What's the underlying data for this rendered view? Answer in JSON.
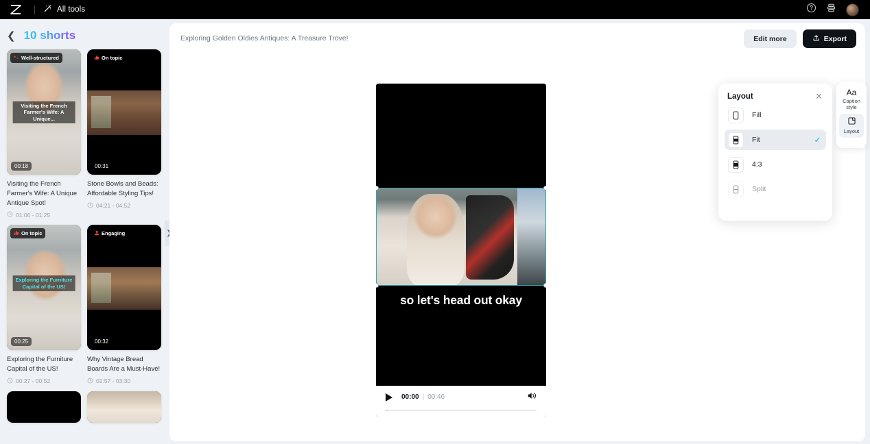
{
  "topbar": {
    "logo_icon": "capcut-logo-icon",
    "all_tools_label": "All tools",
    "all_tools_icon": "magic-wand-icon",
    "help_icon": "help-circle-icon",
    "print_icon": "layers-icon",
    "avatar_icon": "user-avatar"
  },
  "sidebar": {
    "back_icon": "chevron-left-icon",
    "title": "10 shorts",
    "collapse_icon": "chevron-right-icon",
    "cards": [
      {
        "badge": "Well-structured",
        "badge_icon": "sparkles-icon",
        "duration": "00:18",
        "title": "Visiting the French Farmer's Wife: A Unique Antique Spot!",
        "range": "01:06 - 01:25",
        "clock_icon": "clock-icon",
        "overlay_caption": "Visiting the French Farmer's Wife: A Unique...",
        "thumb_kind": "face1"
      },
      {
        "badge": "On topic",
        "badge_icon": "thumbs-up-icon",
        "duration": "00:31",
        "title": "Stone Bowls and Beads: Affordable Styling Tips!",
        "range": "04:21 - 04:52",
        "clock_icon": "clock-icon",
        "overlay_caption": "",
        "thumb_kind": "room"
      },
      {
        "badge": "On topic",
        "badge_icon": "thumbs-up-icon",
        "duration": "00:25",
        "title": "Exploring the Furniture Capital of the US!",
        "range": "00:27 - 00:52",
        "clock_icon": "clock-icon",
        "overlay_caption": "Exploring the Furniture Capital of the US!",
        "thumb_kind": "face2"
      },
      {
        "badge": "Engaging",
        "badge_icon": "person-icon",
        "duration": "00:32",
        "title": "Why Vintage Bread Boards Are a Must-Have!",
        "range": "02:57 - 03:30",
        "clock_icon": "clock-icon",
        "overlay_caption": "",
        "thumb_kind": "room-b"
      },
      {
        "badge": "",
        "duration": "",
        "title": "",
        "range": "",
        "thumb_kind": "black"
      },
      {
        "badge": "",
        "duration": "",
        "title": "",
        "range": "",
        "thumb_kind": "hair"
      }
    ]
  },
  "main": {
    "project_title": "Exploring Golden Oldies Antiques: A Treasure Trove!",
    "edit_more_label": "Edit more",
    "export_label": "Export",
    "export_icon": "export-upload-icon"
  },
  "player": {
    "caption_text": "so let's head out okay",
    "play_icon": "play-icon",
    "current_time": "00:00",
    "separator": "|",
    "total_time": "00:46",
    "volume_icon": "volume-icon",
    "selection_handles": 4
  },
  "layout_panel": {
    "title": "Layout",
    "close_icon": "close-icon",
    "check_icon": "check-icon",
    "options": [
      {
        "label": "Fill",
        "icon": "phone-fill-icon",
        "selected": false,
        "disabled": false
      },
      {
        "label": "Fit",
        "icon": "phone-fit-icon",
        "selected": true,
        "disabled": false
      },
      {
        "label": "4:3",
        "icon": "phone-43-icon",
        "selected": false,
        "disabled": false
      },
      {
        "label": "Split",
        "icon": "phone-split-icon",
        "selected": false,
        "disabled": true
      }
    ]
  },
  "right_tools": [
    {
      "label": "Caption style",
      "icon": "Aa",
      "icon_name": "caption-style-icon",
      "selected": false
    },
    {
      "label": "Layout",
      "icon": "layout-icon",
      "icon_name": "layout-icon",
      "selected": true
    }
  ],
  "colors": {
    "accent_cyan": "#35c3f0",
    "accent_purple": "#8a4df0",
    "selection_border": "#2fa8b8",
    "badge_red": "#e8453c",
    "canvas_bg": "#eef1f5"
  }
}
